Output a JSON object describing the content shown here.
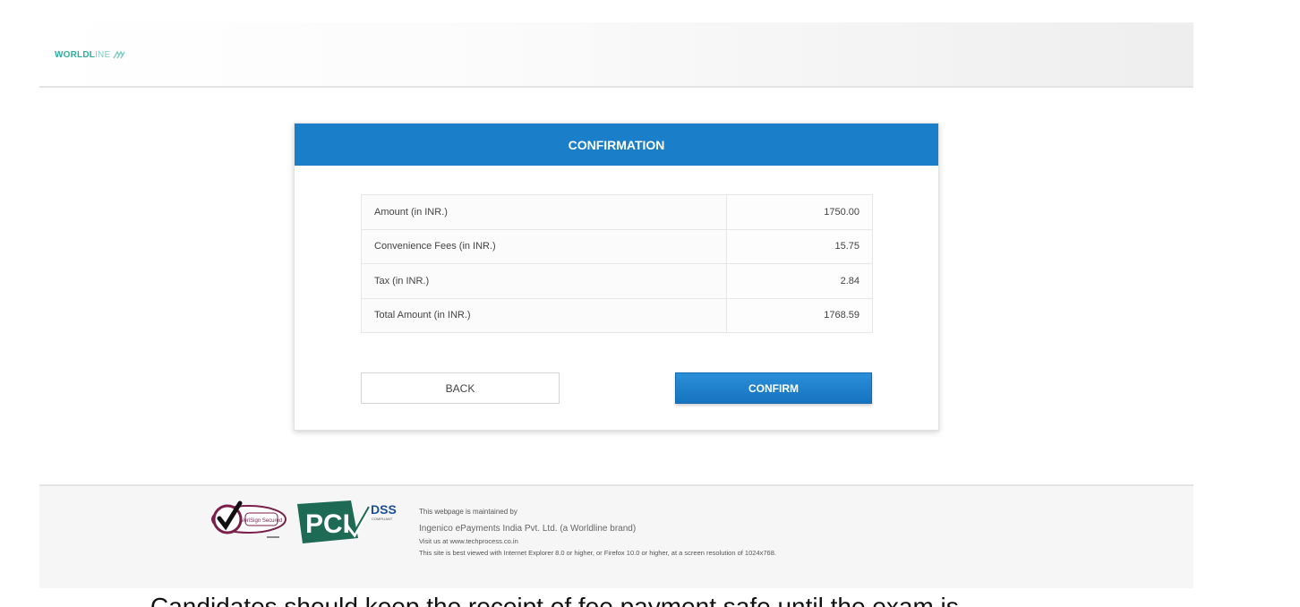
{
  "header": {
    "logo_strong": "WORLDL",
    "logo_light": "INE",
    "logo_icon": "worldline-waves-icon"
  },
  "confirmation": {
    "title": "CONFIRMATION",
    "rows": [
      {
        "label": "Amount (in INR.)",
        "value": "1750.00"
      },
      {
        "label": "Convenience Fees (in INR.)",
        "value": "15.75"
      },
      {
        "label": "Tax (in INR.)",
        "value": "2.84"
      },
      {
        "label": "Total Amount (in INR.)",
        "value": "1768.59"
      }
    ],
    "back_label": "BACK",
    "confirm_label": "CONFIRM"
  },
  "footer": {
    "verisign_badge_text": "VeriSign Secured",
    "pci_text": "PCI",
    "dss_text": "DSS",
    "compliant_text": "COMPLIANT",
    "line1": "This webpage is maintained by",
    "line2": "Ingenico ePayments India Pvt. Ltd. (a Worldline brand)",
    "line3": "Visit us at www.techprocess.co.in",
    "line4": "This site is best viewed with Internet Explorer 8.0 or higher, or Firefox 10.0 or higher, at a screen resolution of 1024x768."
  },
  "bottom_caption": "Candidates should keep the receipt of fee payment safe until the exam is"
}
